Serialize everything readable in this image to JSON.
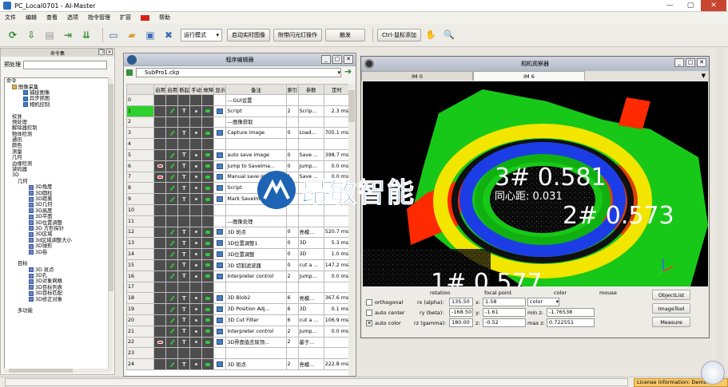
{
  "window": {
    "title": "PC_Local0701 - AI-Master"
  },
  "menu": [
    "文件",
    "编辑",
    "查看",
    "选项",
    "指令管理",
    "扩容",
    "帮助"
  ],
  "toolbar": {
    "run_mode": "运行模式",
    "btn_realtime": "启动实时图像",
    "btn_flash": "附带闪光灯操作",
    "btn_trigger": "触发",
    "btn_hotkey": "Ctrl-鼠标添加"
  },
  "left_panel": {
    "title": "命令集",
    "search_label": "预处理",
    "tree": [
      {
        "label": "命令",
        "level": 0,
        "icon": ""
      },
      {
        "label": "图像采集",
        "level": 1,
        "icon": "fld"
      },
      {
        "label": "捕捉图像",
        "level": 3,
        "icon": "img"
      },
      {
        "label": "异步抓图",
        "level": 3,
        "icon": "img"
      },
      {
        "label": "相机控制",
        "level": 3,
        "icon": "img"
      },
      {
        "label": "",
        "level": 1,
        "icon": ""
      },
      {
        "label": "校准",
        "level": 1,
        "icon": ""
      },
      {
        "label": "预处理",
        "level": 1,
        "icon": ""
      },
      {
        "label": "解除器控制",
        "level": 1,
        "icon": ""
      },
      {
        "label": "物体检测",
        "level": 1,
        "icon": ""
      },
      {
        "label": "通讯",
        "level": 1,
        "icon": ""
      },
      {
        "label": "颜色",
        "level": 1,
        "icon": ""
      },
      {
        "label": "测量",
        "level": 1,
        "icon": ""
      },
      {
        "label": "几何",
        "level": 1,
        "icon": ""
      },
      {
        "label": "边缘检测",
        "level": 1,
        "icon": ""
      },
      {
        "label": "读码器",
        "level": 1,
        "icon": ""
      },
      {
        "label": "3D",
        "level": 1,
        "icon": ""
      },
      {
        "label": "几何",
        "level": 2,
        "icon": ""
      },
      {
        "label": "3D角度",
        "level": 4,
        "icon": "cube"
      },
      {
        "label": "3D圆柱",
        "level": 4,
        "icon": "cube"
      },
      {
        "label": "3D距离",
        "level": 4,
        "icon": "cube"
      },
      {
        "label": "3D几何",
        "level": 4,
        "icon": "cube"
      },
      {
        "label": "3D高度",
        "level": 4,
        "icon": "cube"
      },
      {
        "label": "3D平面",
        "level": 4,
        "icon": "cube"
      },
      {
        "label": "3D位置调整",
        "level": 4,
        "icon": "cube"
      },
      {
        "label": "3D 方形探针",
        "level": 4,
        "icon": "cube"
      },
      {
        "label": "3D区域",
        "level": 4,
        "icon": "cube"
      },
      {
        "label": "3d区域调整大小",
        "level": 4,
        "icon": "cube"
      },
      {
        "label": "3D球形",
        "level": 4,
        "icon": "cube"
      },
      {
        "label": "3D卷",
        "level": 4,
        "icon": "cube"
      },
      {
        "label": "",
        "level": 2,
        "icon": ""
      },
      {
        "label": "目标",
        "level": 2,
        "icon": ""
      },
      {
        "label": "3D 斑点",
        "level": 4,
        "icon": "cube"
      },
      {
        "label": "3D孔",
        "level": 4,
        "icon": "cube"
      },
      {
        "label": "3D对象网格",
        "level": 4,
        "icon": "cube"
      },
      {
        "label": "3D目标列表",
        "level": 4,
        "icon": "cube"
      },
      {
        "label": "3D目标匹配",
        "level": 4,
        "icon": "cube"
      },
      {
        "label": "3D修正对象",
        "level": 4,
        "icon": "cube"
      },
      {
        "label": "",
        "level": 2,
        "icon": ""
      },
      {
        "label": "多功能",
        "level": 2,
        "icon": ""
      }
    ]
  },
  "editor": {
    "title": "程序编辑器",
    "file": "SubPro1.ckp",
    "headers": [
      "",
      "启用",
      "启用",
      "断起",
      "手动",
      "故障",
      "显示",
      "备注",
      "索引",
      "参数",
      "定时"
    ],
    "rows": [
      {
        "n": "0",
        "state": "",
        "mark": "",
        "note": "---GUI设置",
        "idx": "",
        "param": "",
        "time": ""
      },
      {
        "n": "1",
        "state": "ok",
        "mark": "icon",
        "note": "Script",
        "idx": "2",
        "param": "Scrip...",
        "time": "2.3 ms"
      },
      {
        "n": "2",
        "state": "",
        "mark": "",
        "note": "---图像获取",
        "idx": "",
        "param": "",
        "time": ""
      },
      {
        "n": "3",
        "state": "",
        "mark": "icon",
        "note": "Capture image",
        "idx": "0",
        "param": "Load...",
        "time": "705.1 ms"
      },
      {
        "n": "4",
        "state": "",
        "mark": "",
        "note": "",
        "idx": "",
        "param": "",
        "time": ""
      },
      {
        "n": "5",
        "state": "",
        "mark": "icon",
        "note": "auto save image",
        "idx": "0",
        "param": "Save ...",
        "time": "398.7 ms"
      },
      {
        "n": "6",
        "state": "red",
        "mark": "icon",
        "note": "Jump to SaveIma...",
        "idx": "0",
        "param": "Jump...",
        "time": "0.0 ms"
      },
      {
        "n": "7",
        "state": "red",
        "mark": "icon",
        "note": "Manual save im...",
        "idx": "1",
        "param": "Save ...",
        "time": "0.0 ms"
      },
      {
        "n": "8",
        "state": "",
        "mark": "icon",
        "note": "Script",
        "idx": "",
        "param": "",
        "time": ""
      },
      {
        "n": "9",
        "state": "",
        "mark": "icon",
        "note": "Mark SaveIma...",
        "idx": "",
        "param": "",
        "time": ""
      },
      {
        "n": "10",
        "state": "",
        "mark": "",
        "note": "",
        "idx": "",
        "param": "",
        "time": ""
      },
      {
        "n": "11",
        "state": "",
        "mark": "",
        "note": "---图像处理",
        "idx": "",
        "param": "",
        "time": ""
      },
      {
        "n": "12",
        "state": "",
        "mark": "icon",
        "note": "3D 斑点",
        "idx": "0",
        "param": "亮模...",
        "time": "520.7 ms"
      },
      {
        "n": "13",
        "state": "",
        "mark": "icon",
        "note": "3D位置调整1",
        "idx": "0",
        "param": "3D",
        "time": "5.3 ms"
      },
      {
        "n": "14",
        "state": "",
        "mark": "icon",
        "note": "3D位置调整",
        "idx": "0",
        "param": "3D",
        "time": "1.0 ms"
      },
      {
        "n": "15",
        "state": "",
        "mark": "icon",
        "note": "3D 切割滤波器",
        "idx": "0",
        "param": "cut a ...",
        "time": "147.2 ms"
      },
      {
        "n": "16",
        "state": "",
        "mark": "icon",
        "note": "Interpreter control",
        "idx": "2",
        "param": "Jump...",
        "time": "0.0 ms"
      },
      {
        "n": "17",
        "state": "",
        "mark": "",
        "note": "",
        "idx": "",
        "param": "",
        "time": ""
      },
      {
        "n": "18",
        "state": "",
        "mark": "icon",
        "note": "3D Blob2",
        "idx": "6",
        "param": "亮模...",
        "time": "367.6 ms"
      },
      {
        "n": "19",
        "state": "",
        "mark": "icon",
        "note": "3D Position Adj...",
        "idx": "6",
        "param": "3D",
        "time": "0.1 ms"
      },
      {
        "n": "20",
        "state": "",
        "mark": "icon",
        "note": "3D Cut Filter",
        "idx": "6",
        "param": "cut a ...",
        "time": "106.9 ms"
      },
      {
        "n": "21",
        "state": "",
        "mark": "icon",
        "note": "Interpreter control",
        "idx": "2",
        "param": "Jump...",
        "time": "0.0 ms"
      },
      {
        "n": "22",
        "state": "red",
        "mark": "icon",
        "note": "3D界面值去除顶...",
        "idx": "2",
        "param": "基于...",
        "time": ""
      },
      {
        "n": "23",
        "state": "",
        "mark": "",
        "note": "",
        "idx": "",
        "param": "",
        "time": ""
      },
      {
        "n": "24",
        "state": "",
        "mark": "icon",
        "note": "3D 斑点",
        "idx": "2",
        "param": "亮模...",
        "time": "222.8 ms"
      }
    ]
  },
  "camera": {
    "title": "相机观察器",
    "tabs": [
      "IM 0",
      "IM 6"
    ],
    "labels": {
      "l3": "3# 0.581",
      "l2": "2# 0.573",
      "l1": "1# 0.577",
      "center": "同心距: 0.031"
    },
    "controls": {
      "headers": {
        "rotation": "rotation",
        "focal": "focal point",
        "color": "color",
        "mouse": "mouse"
      },
      "orthogonal": "orthogonal",
      "auto_center": "auto center",
      "auto_color": "auto color",
      "rx_label": "rx (alpha):",
      "rx": "135.50",
      "ry_label": "ry (beta):",
      "ry": "-168.50",
      "rz_label": "rz (gamma):",
      "rz": "180.00",
      "x_label": "x:",
      "x": "1.58",
      "y_label": "y:",
      "y": "-1.61",
      "z_label": "z:",
      "z": "-0.52",
      "color_sel": "color",
      "minz_label": "min z:",
      "minz": "-1.76538",
      "maxz_label": "max z:",
      "maxz": "0.722551",
      "btn_objlist": "ObjectList",
      "btn_imgtool": "ImageTool",
      "btn_measure": "Measure"
    }
  },
  "watermark": "昂敏智能",
  "status": {
    "license": "License information: Demo"
  }
}
